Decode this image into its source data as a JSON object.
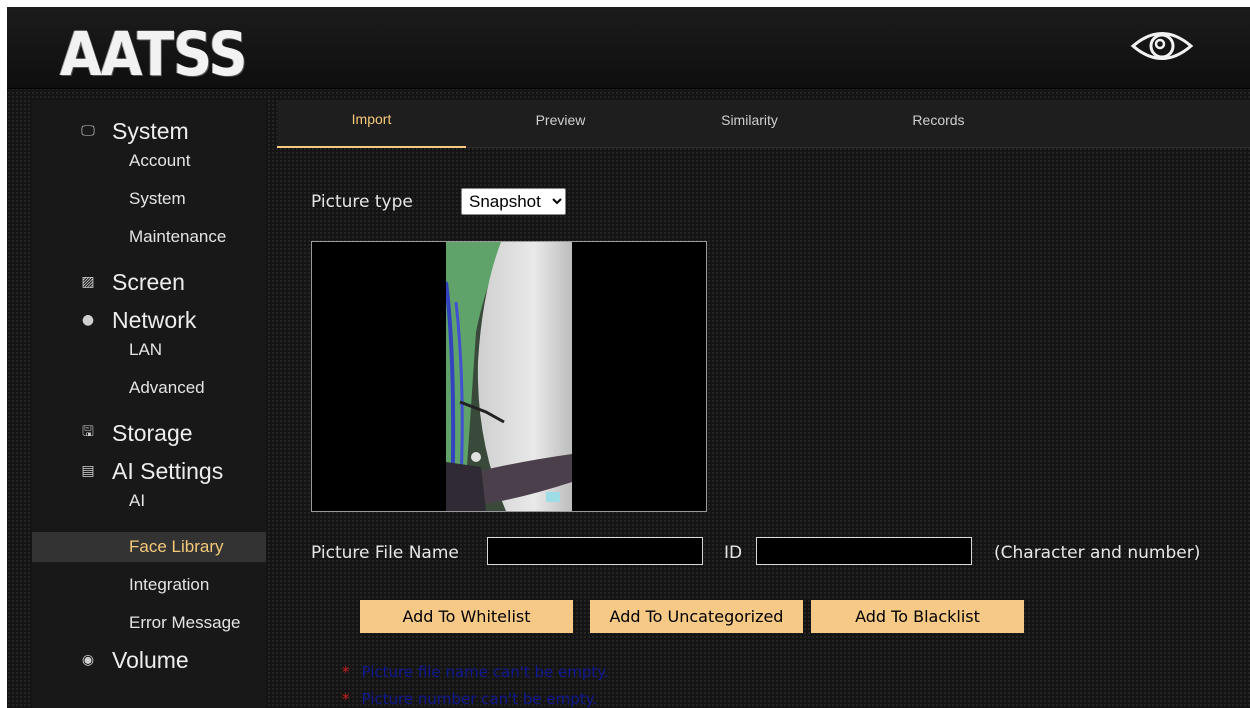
{
  "header": {
    "logo_text": "AATSS",
    "eye_icon": "eye-icon"
  },
  "sidebar": {
    "groups": [
      {
        "icon": "monitor-icon",
        "label": "System",
        "items": [
          "Account",
          "System",
          "Maintenance"
        ]
      },
      {
        "icon": "image-icon",
        "label": "Screen",
        "items": []
      },
      {
        "icon": "globe-icon",
        "label": "Network",
        "items": [
          "LAN",
          "Advanced"
        ]
      },
      {
        "icon": "floppy-disk-icon",
        "label": "Storage",
        "items": []
      },
      {
        "icon": "document-icon",
        "label": "AI Settings",
        "items": [
          "AI",
          "Face Library",
          "Integration",
          "Error Message"
        ]
      },
      {
        "icon": "speaker-icon",
        "label": "Volume",
        "items": []
      }
    ],
    "active_item": "Face Library"
  },
  "tabs": [
    {
      "label": "Import",
      "active": true
    },
    {
      "label": "Preview",
      "active": false
    },
    {
      "label": "Similarity",
      "active": false
    },
    {
      "label": "Records",
      "active": false
    }
  ],
  "form": {
    "picture_type_label": "Picture type",
    "picture_type_value": "Snapshot",
    "file_name_label": "Picture File Name",
    "file_name_value": "",
    "id_label": "ID",
    "id_value": "",
    "hint": "(Character and number)"
  },
  "buttons": {
    "whitelist": "Add To Whitelist",
    "uncategorized": "Add To Uncategorized",
    "blacklist": "Add To Blacklist"
  },
  "errors": [
    {
      "star": "*",
      "text": "Picture file name can't be empty."
    },
    {
      "star": "*",
      "text": "Picture number can't be empty."
    }
  ],
  "colors": {
    "accent": "#f5c97a",
    "button_bg": "#f7c987",
    "error_star": "#cc1f1f",
    "error_text": "#101890"
  }
}
